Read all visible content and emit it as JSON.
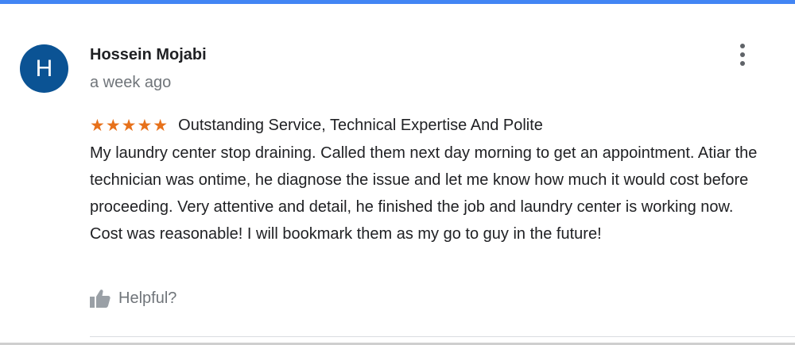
{
  "review": {
    "avatar_letter": "H",
    "author": "Hossein Mojabi",
    "time": "a week ago",
    "stars": "★★★★★",
    "rating": 5,
    "title": "Outstanding Service, Technical Expertise And Polite",
    "body_lines": [
      "My laundry center stop draining. Called them next day morning to get an appointment. Atiar the technician was ontime, he diagnose the issue and let me know how much it would cost before proceeding. Very attentive and detail, he finished the job and laundry center is working now.",
      "Cost was reasonable! I will bookmark them as my go to guy in the future!"
    ],
    "helpful_label": "Helpful?"
  },
  "colors": {
    "accent_bar": "#4285f4",
    "avatar_bg": "#0b5394",
    "star": "#e7711b",
    "secondary_text": "#70757a"
  },
  "icons": {
    "menu": "more-vert-icon",
    "helpful": "thumbs-up-icon"
  }
}
